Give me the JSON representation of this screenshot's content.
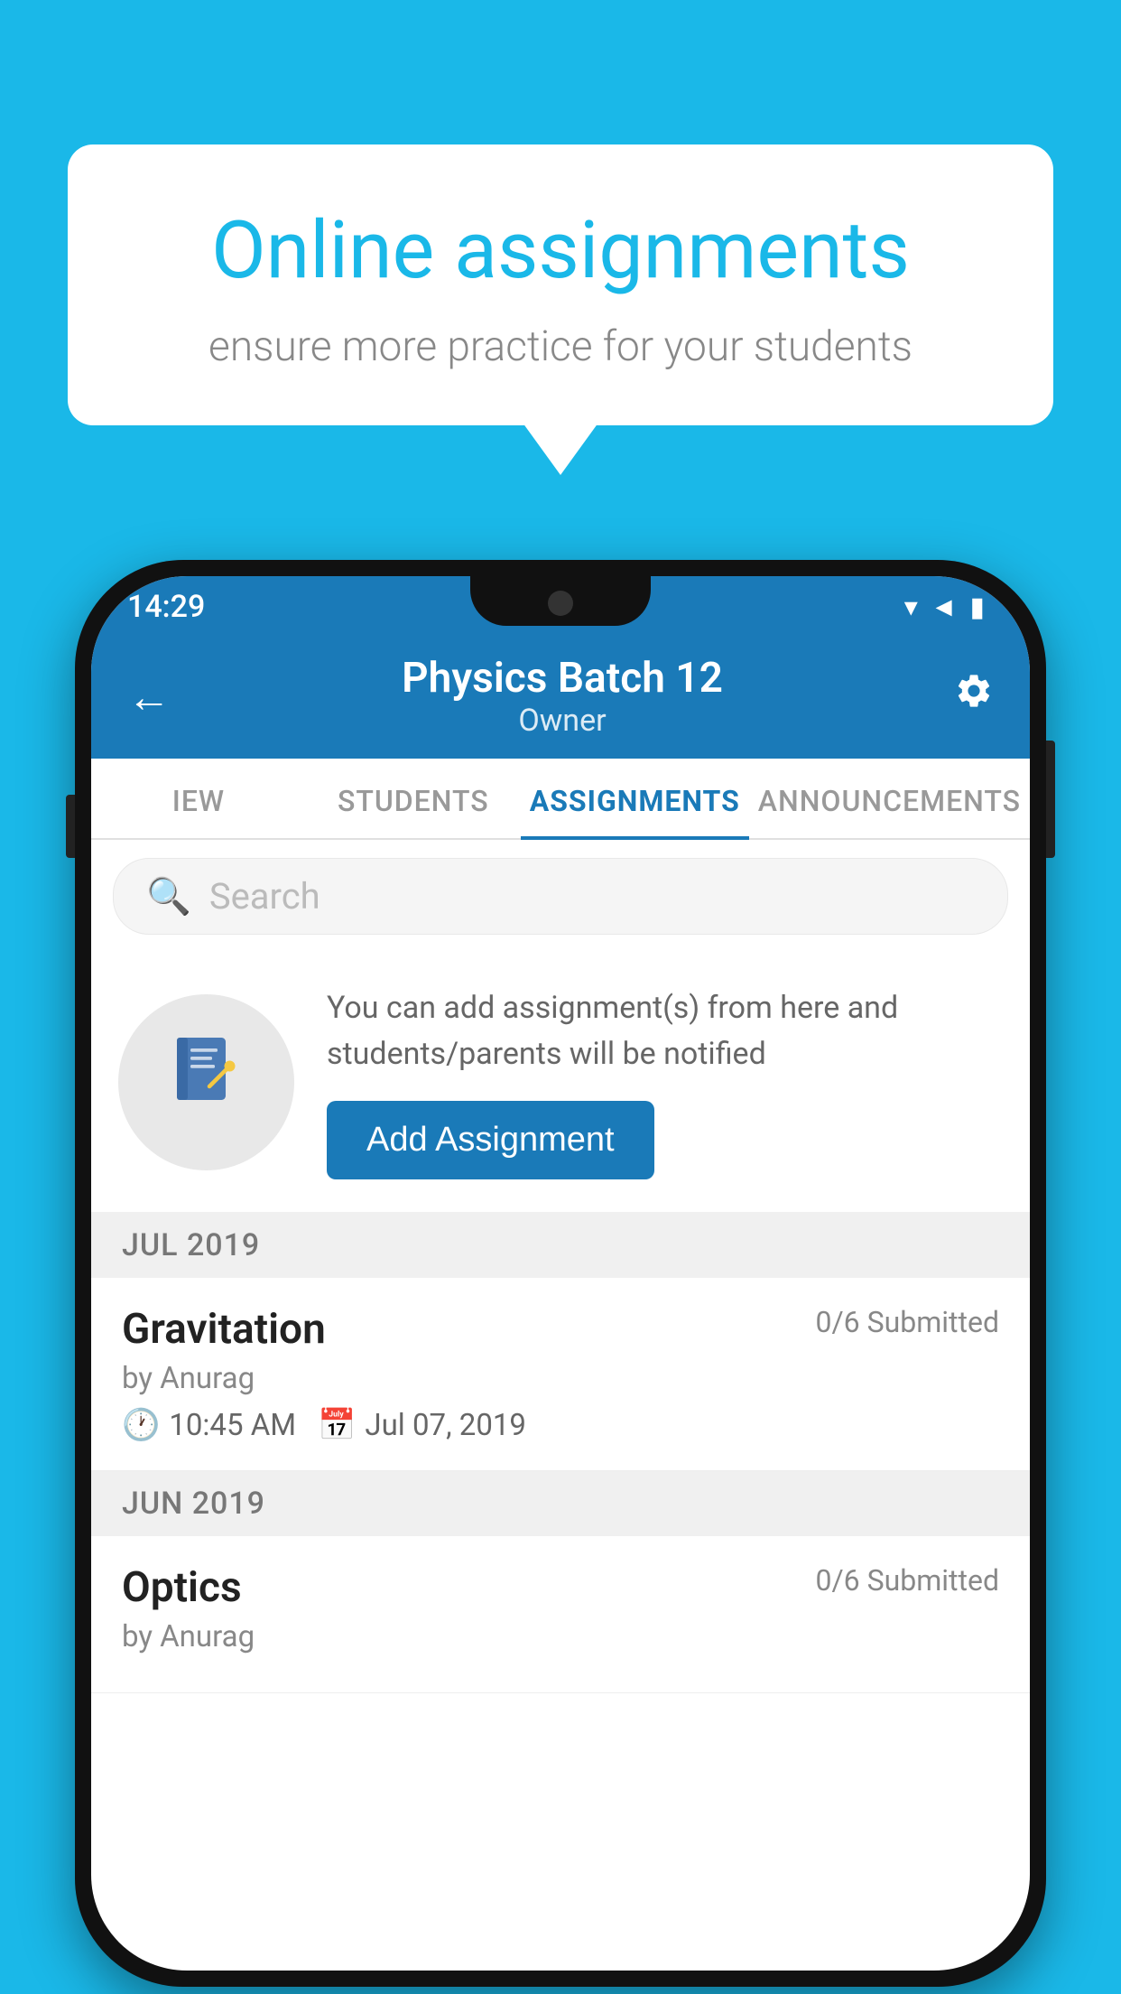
{
  "background_color": "#1ab8e8",
  "speech_bubble": {
    "title": "Online assignments",
    "subtitle": "ensure more practice for your students"
  },
  "phone": {
    "status_bar": {
      "time": "14:29",
      "icons": [
        "wifi",
        "signal",
        "battery"
      ]
    },
    "header": {
      "title": "Physics Batch 12",
      "subtitle": "Owner",
      "back_label": "←",
      "settings_label": "⚙"
    },
    "tabs": [
      {
        "label": "IEW",
        "active": false
      },
      {
        "label": "STUDENTS",
        "active": false
      },
      {
        "label": "ASSIGNMENTS",
        "active": true
      },
      {
        "label": "ANNOUNCEMENTS",
        "active": false
      }
    ],
    "search": {
      "placeholder": "Search"
    },
    "add_assignment_section": {
      "info_text": "You can add assignment(s) from here and students/parents will be notified",
      "button_label": "Add Assignment"
    },
    "sections": [
      {
        "month": "JUL 2019",
        "assignments": [
          {
            "title": "Gravitation",
            "submitted": "0/6 Submitted",
            "by": "by Anurag",
            "time": "10:45 AM",
            "date": "Jul 07, 2019"
          }
        ]
      },
      {
        "month": "JUN 2019",
        "assignments": [
          {
            "title": "Optics",
            "submitted": "0/6 Submitted",
            "by": "by Anurag",
            "time": "",
            "date": ""
          }
        ]
      }
    ]
  }
}
